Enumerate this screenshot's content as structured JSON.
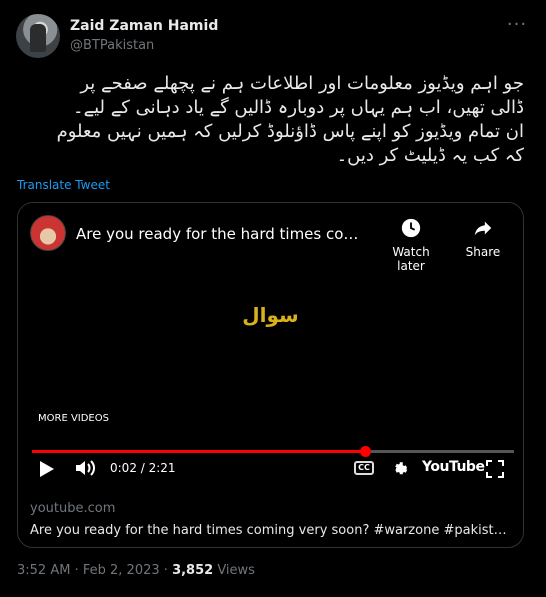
{
  "author": {
    "name": "Zaid Zaman Hamid",
    "handle": "@BTPakistan"
  },
  "tweet": {
    "lines": [
      "جو اہم ویڈیوز معلومات اور اطلاعات ہم نے پچھلے صفحے پر",
      "ڈالی تھیں، اب ہم یہاں پر دوبارہ ڈالیں گے یاد دہانی کے لیے۔",
      "ان تمام ویڈیوز کو اپنے پاس ڈاؤنلوڈ کرلیں کہ ہمیں نہیں معلوم",
      "کہ کب یہ ڈیلیٹ کر دیں۔"
    ],
    "translate_label": "Translate Tweet"
  },
  "video": {
    "title": "Are you ready for the hard times comin...",
    "watch_later": "Watch later",
    "share": "Share",
    "overlay_text": "سوال",
    "more_videos": "MORE VIDEOS",
    "time": "0:02 / 2:21",
    "progress": 0.69,
    "cc_label": "CC",
    "youtube_label": "YouTube"
  },
  "card": {
    "domain": "youtube.com",
    "title": "Are you ready for the hard times coming very soon? #warzone #pakistan..."
  },
  "meta": {
    "time": "3:52 AM",
    "sep": "·",
    "date": "Feb 2, 2023",
    "sep2": "·",
    "views_count": "3,852",
    "views_label": "Views"
  },
  "colors": {
    "link": "#1d9bf0",
    "progress": "#ff0000",
    "overlay": "#d9b11a"
  }
}
